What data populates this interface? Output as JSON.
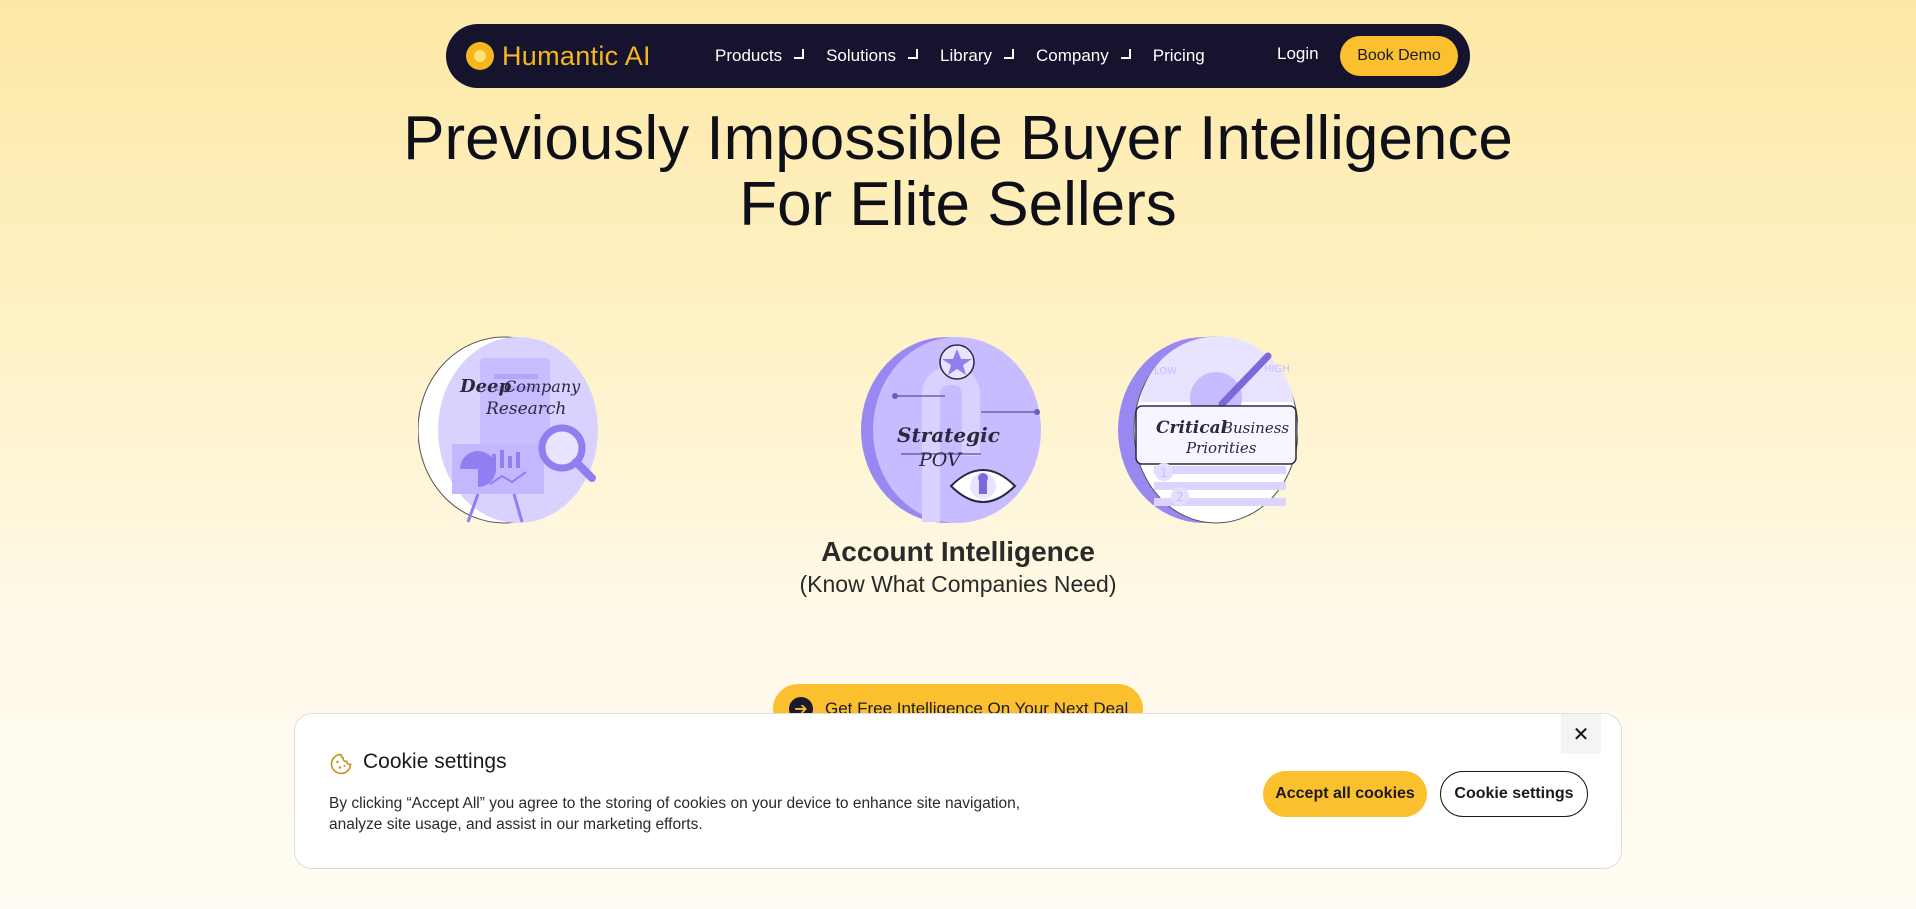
{
  "nav": {
    "brand": "Humantic AI",
    "items": [
      {
        "label": "Products",
        "dropdown": true
      },
      {
        "label": "Solutions",
        "dropdown": true
      },
      {
        "label": "Library",
        "dropdown": true
      },
      {
        "label": "Company",
        "dropdown": true
      },
      {
        "label": "Pricing",
        "dropdown": false
      }
    ],
    "login": "Login",
    "book_demo": "Book Demo"
  },
  "hero": {
    "title_line1": "Previously Impossible Buyer Intelligence",
    "title_line2": "For Elite Sellers"
  },
  "coins": {
    "left": {
      "line1": "Deep",
      "line1b": "Company",
      "line2": "Research"
    },
    "center": {
      "line1": "Strategic",
      "line2": "POV"
    },
    "right": {
      "line1": "Critical",
      "line1b": "Business",
      "line2": "Priorities",
      "gauge_low": "LOW",
      "gauge_high": "HIGH",
      "n1": "1",
      "n2": "2"
    }
  },
  "section": {
    "title": "Account Intelligence",
    "subtitle": "(Know What Companies Need)"
  },
  "cta": {
    "label": "Get Free Intelligence On Your Next Deal"
  },
  "cookie": {
    "title": "Cookie settings",
    "text": "By clicking “Accept All” you agree  to the storing of cookies on your device to enhance site navigation, analyze site usage, and assist in our marketing efforts.",
    "accept": "Accept all cookies",
    "settings": "Cookie settings",
    "close": "✕"
  },
  "colors": {
    "accent": "#fbc02d",
    "nav_bg": "#15132e",
    "coin_purple": "#a594f9",
    "coin_light": "#dcd6ff"
  }
}
